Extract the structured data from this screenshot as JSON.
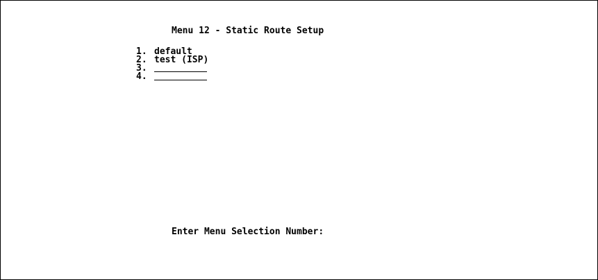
{
  "menu": {
    "title": "Menu 12 - Static Route Setup",
    "items": [
      {
        "number": "1.",
        "label": "default"
      },
      {
        "number": "2.",
        "label": "test (ISP)"
      },
      {
        "number": "3.",
        "label": ""
      },
      {
        "number": "4.",
        "label": ""
      }
    ]
  },
  "prompt": {
    "text": "Enter Menu Selection Number:",
    "value": ""
  }
}
